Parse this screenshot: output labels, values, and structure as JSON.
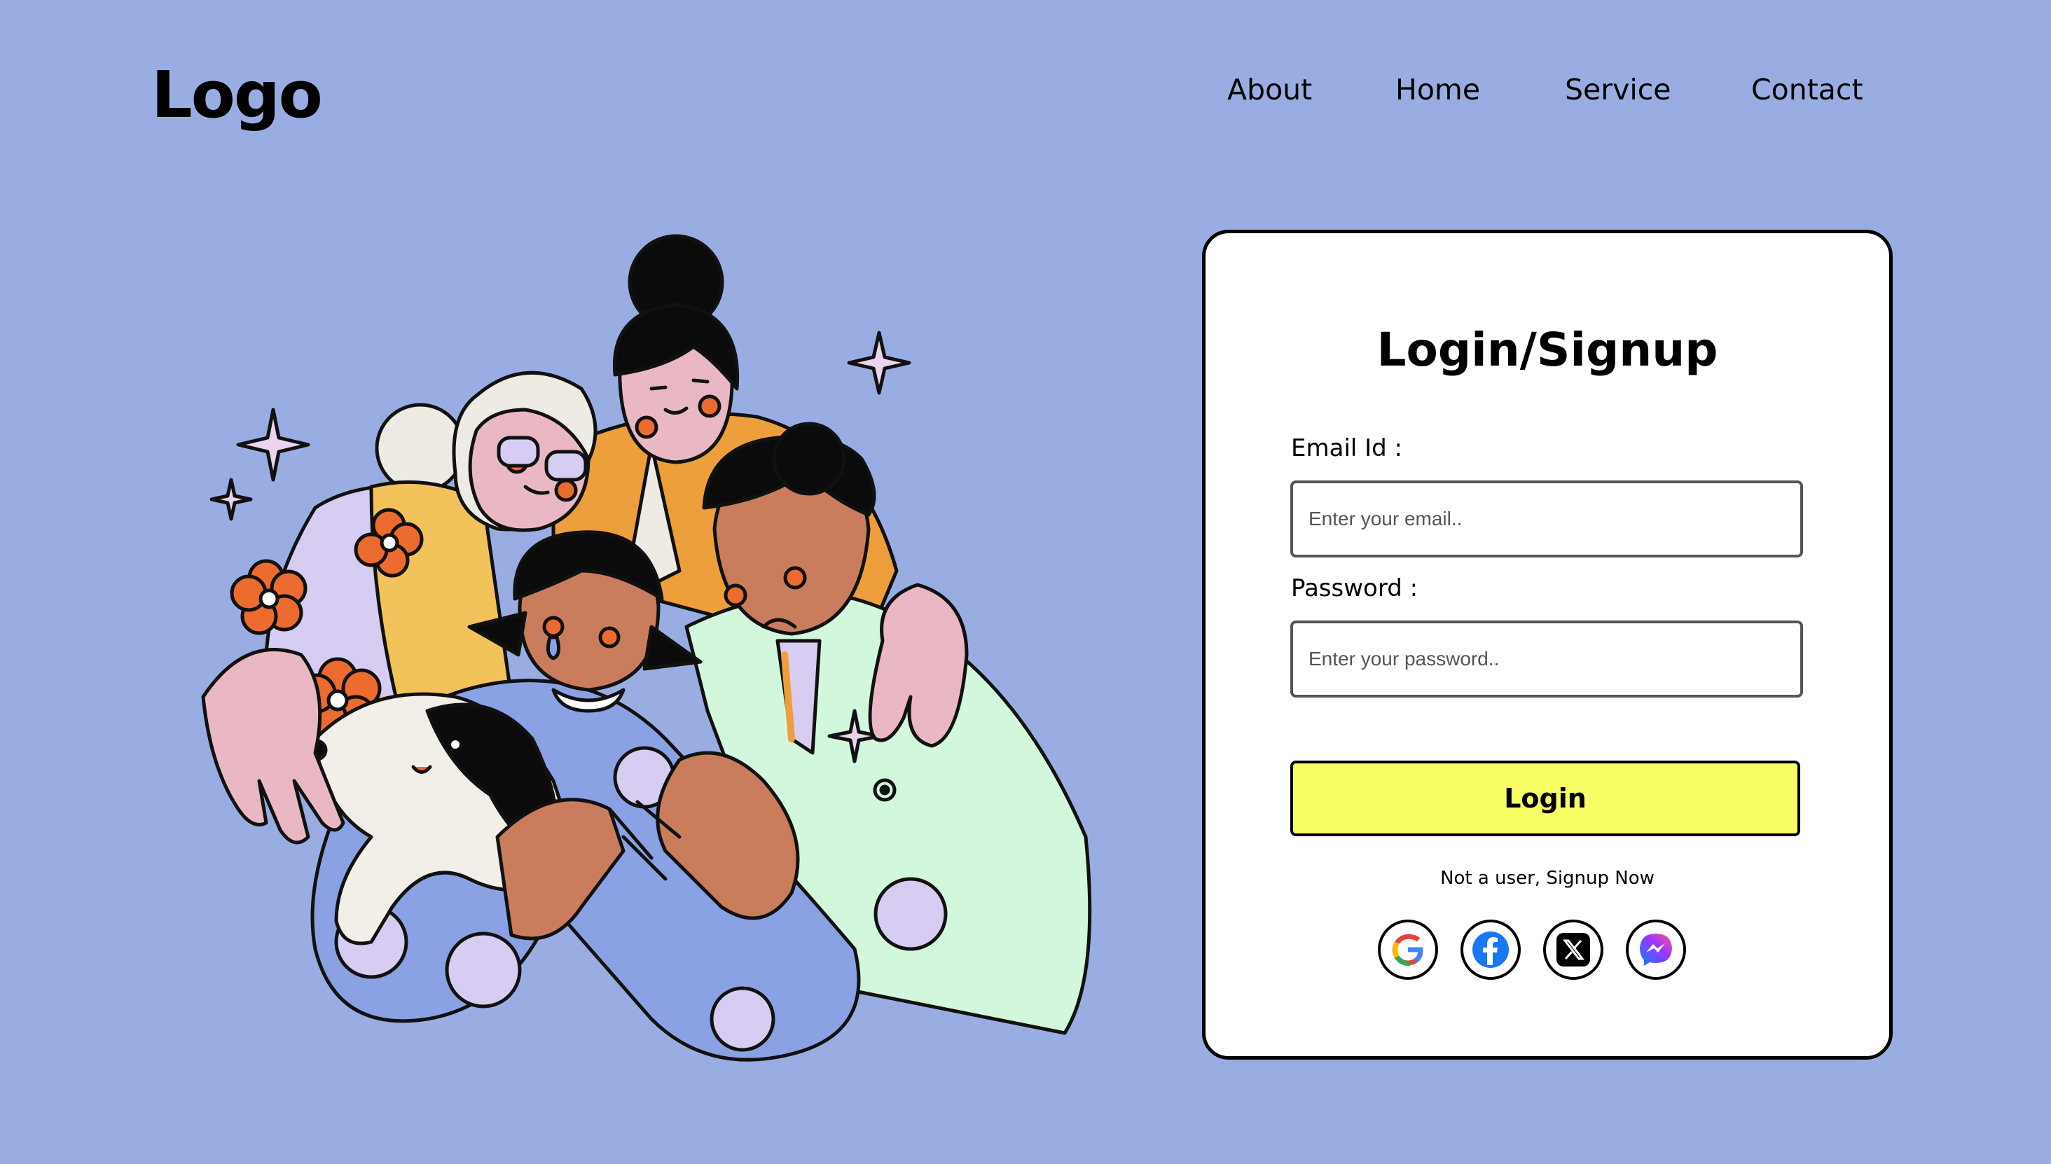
{
  "header": {
    "logo": "Logo",
    "nav": [
      {
        "label": "About"
      },
      {
        "label": "Home"
      },
      {
        "label": "Service"
      },
      {
        "label": "Contact"
      }
    ]
  },
  "login": {
    "title": "Login/Signup",
    "email_label": "Email Id :",
    "email_placeholder": "Enter your email..",
    "password_label": "Password :",
    "password_placeholder": "Enter your password..",
    "login_button": "Login",
    "signup_text": "Not a user, Signup Now",
    "socials": [
      "google-icon",
      "facebook-icon",
      "x-icon",
      "messenger-icon"
    ]
  },
  "colors": {
    "background": "#9aade3",
    "button": "#f7fd63",
    "card": "#ffffff"
  }
}
